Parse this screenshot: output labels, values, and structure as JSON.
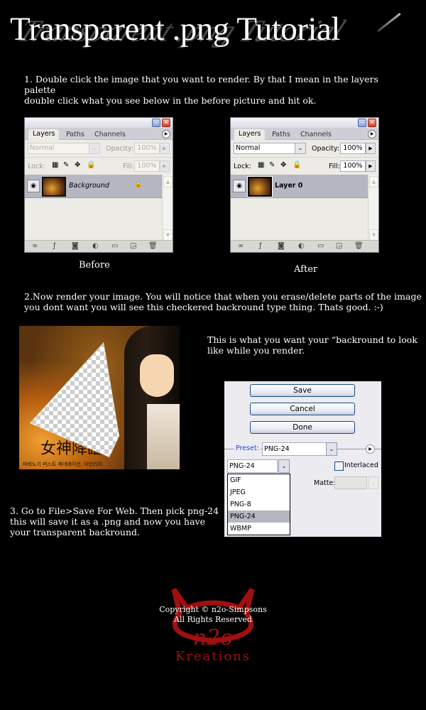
{
  "title": "Transparent .png Tutorial",
  "step1": {
    "text_line1": "1. Double click the image that you want to render. By that I mean in the layers palette",
    "text_line2": "double click what you see below in the before picture and hit ok."
  },
  "palettes": {
    "before": {
      "caption": "Before",
      "tabs": [
        "Layers",
        "Paths",
        "Channels"
      ],
      "blend_mode": "Normal",
      "opacity_label": "Opacity:",
      "opacity_value": "100%",
      "lock_label": "Lock:",
      "fill_label": "Fill:",
      "fill_value": "100%",
      "layer_name": "Background",
      "layer_locked": true
    },
    "after": {
      "caption": "After",
      "tabs": [
        "Layers",
        "Paths",
        "Channels"
      ],
      "blend_mode": "Normal",
      "opacity_label": "Opacity:",
      "opacity_value": "100%",
      "lock_label": "Lock:",
      "fill_label": "Fill:",
      "fill_value": "100%",
      "layer_name": "Layer 0",
      "layer_locked": false
    }
  },
  "step2": {
    "text_line1": "2.Now render your image. You will notice that when you erase/delete parts of the image",
    "text_line2": "you dont want you will see this checkered backround type thing. Thats good. :-)"
  },
  "render_note": {
    "line1": "This is what you want your “backround to look",
    "line2": "like while you render."
  },
  "render_image": {
    "kanji": "女神降臨",
    "small_text": "마비노기 퍼스트 제네레이션, 아인리히"
  },
  "save_for_web": {
    "buttons": [
      "Save",
      "Cancel",
      "Done"
    ],
    "preset_label": "Preset:",
    "preset_value": "PNG-24",
    "format_value": "PNG-24",
    "interlaced_label": "Interlaced",
    "interlaced_checked": false,
    "matte_label": "Matte:",
    "format_options": [
      "GIF",
      "JPEG",
      "PNG-8",
      "PNG-24",
      "WBMP"
    ],
    "selected_option": "PNG-24"
  },
  "step3": {
    "line1": "3. Go to File>Save For Web. Then pick png-24",
    "line2": "this will save it as a .png and now you have",
    "line3": "your transparent backround."
  },
  "footer": {
    "copyright_line1": "Copyright © n2o-Simpsons",
    "copyright_line2": "All Rights Reserved",
    "logo_text_top": "n2o",
    "logo_text_bottom": "Kreations",
    "logo_color": "#a01010"
  }
}
